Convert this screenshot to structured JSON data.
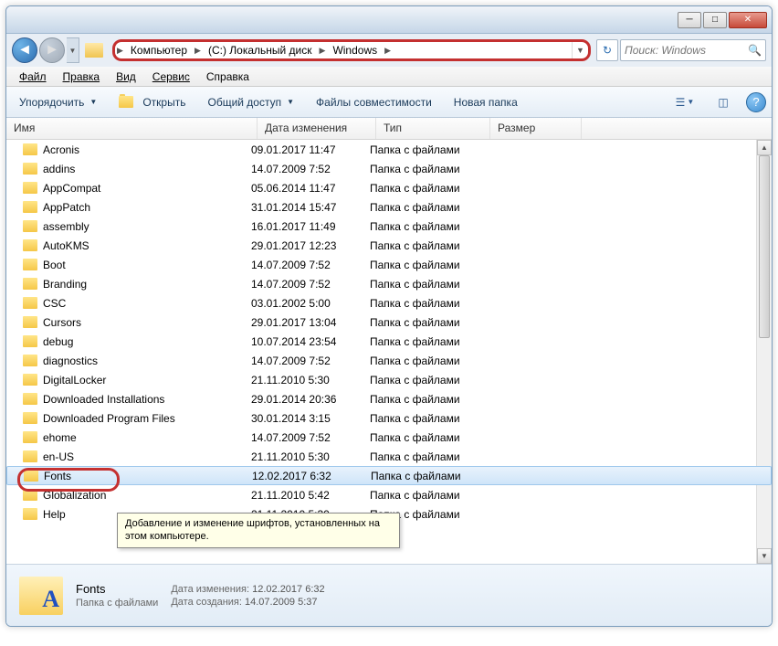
{
  "titlebar": {
    "minimize": "─",
    "maximize": "□",
    "close": "✕"
  },
  "nav": {
    "back": "◄",
    "forward": "►"
  },
  "breadcrumbs": [
    {
      "label": "Компьютер"
    },
    {
      "label": "(C:) Локальный диск"
    },
    {
      "label": "Windows"
    }
  ],
  "search": {
    "placeholder": "Поиск: Windows"
  },
  "menu": [
    {
      "label": "Файл",
      "u": 0
    },
    {
      "label": "Правка",
      "u": 0
    },
    {
      "label": "Вид",
      "u": 0
    },
    {
      "label": "Сервис",
      "u": 0
    },
    {
      "label": "Справка",
      "u": 1
    }
  ],
  "toolbar": {
    "organize": "Упорядочить",
    "open": "Открыть",
    "share": "Общий доступ",
    "compat": "Файлы совместимости",
    "newfolder": "Новая папка"
  },
  "columns": {
    "name": "Имя",
    "date": "Дата изменения",
    "type": "Тип",
    "size": "Размер"
  },
  "rows": [
    {
      "name": "Acronis",
      "date": "09.01.2017 11:47",
      "type": "Папка с файлами"
    },
    {
      "name": "addins",
      "date": "14.07.2009 7:52",
      "type": "Папка с файлами"
    },
    {
      "name": "AppCompat",
      "date": "05.06.2014 11:47",
      "type": "Папка с файлами"
    },
    {
      "name": "AppPatch",
      "date": "31.01.2014 15:47",
      "type": "Папка с файлами"
    },
    {
      "name": "assembly",
      "date": "16.01.2017 11:49",
      "type": "Папка с файлами"
    },
    {
      "name": "AutoKMS",
      "date": "29.01.2017 12:23",
      "type": "Папка с файлами"
    },
    {
      "name": "Boot",
      "date": "14.07.2009 7:52",
      "type": "Папка с файлами"
    },
    {
      "name": "Branding",
      "date": "14.07.2009 7:52",
      "type": "Папка с файлами"
    },
    {
      "name": "CSC",
      "date": "03.01.2002 5:00",
      "type": "Папка с файлами"
    },
    {
      "name": "Cursors",
      "date": "29.01.2017 13:04",
      "type": "Папка с файлами"
    },
    {
      "name": "debug",
      "date": "10.07.2014 23:54",
      "type": "Папка с файлами"
    },
    {
      "name": "diagnostics",
      "date": "14.07.2009 7:52",
      "type": "Папка с файлами"
    },
    {
      "name": "DigitalLocker",
      "date": "21.11.2010 5:30",
      "type": "Папка с файлами"
    },
    {
      "name": "Downloaded Installations",
      "date": "29.01.2014 20:36",
      "type": "Папка с файлами"
    },
    {
      "name": "Downloaded Program Files",
      "date": "30.01.2014 3:15",
      "type": "Папка с файлами"
    },
    {
      "name": "ehome",
      "date": "14.07.2009 7:52",
      "type": "Папка с файлами"
    },
    {
      "name": "en-US",
      "date": "21.11.2010 5:30",
      "type": "Папка с файлами"
    },
    {
      "name": "Fonts",
      "date": "12.02.2017 6:32",
      "type": "Папка с файлами",
      "selected": true,
      "highlighted": true
    },
    {
      "name": "Globalization",
      "date": "21.11.2010 5:42",
      "type": "Папка с файлами"
    },
    {
      "name": "Help",
      "date": "21.11.2010 5:30",
      "type": "Папка с файлами"
    }
  ],
  "tooltip": "Добавление и изменение шрифтов, установленных на этом компьютере.",
  "details": {
    "name": "Fonts",
    "type": "Папка с файлами",
    "mod_label": "Дата изменения:",
    "mod_value": "12.02.2017 6:32",
    "created_label": "Дата создания:",
    "created_value": "14.07.2009 5:37"
  }
}
